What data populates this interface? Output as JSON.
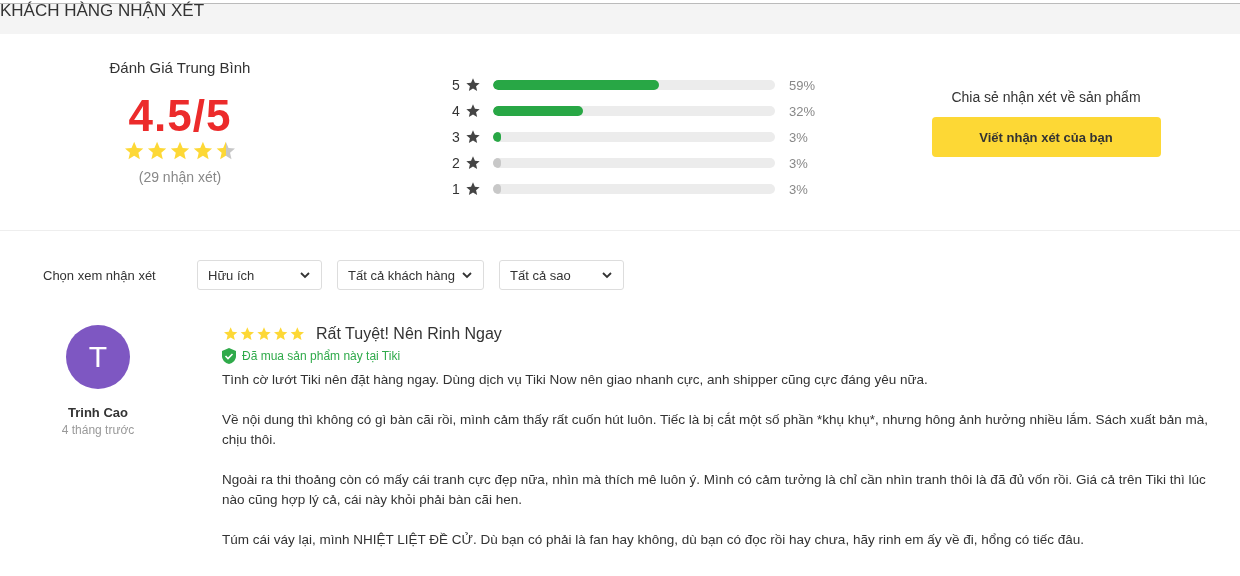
{
  "section_title": "KHÁCH HÀNG NHẬN XÉT",
  "summary": {
    "heading": "Đánh Giá Trung Bình",
    "score": "4.5/5",
    "stars": 4.5,
    "count": "(29 nhận xét)"
  },
  "distribution": [
    {
      "label": "5",
      "level": 0.59,
      "reading": "59%",
      "color": "#28a745"
    },
    {
      "label": "4",
      "level": 0.32,
      "reading": "32%",
      "color": "#28a745"
    },
    {
      "label": "3",
      "level": 0.03,
      "reading": "3%",
      "color": "#28a745"
    },
    {
      "label": "2",
      "level": 0.03,
      "reading": "3%",
      "color": "#c8c8c8"
    },
    {
      "label": "1",
      "level": 0.03,
      "reading": "3%",
      "color": "#c8c8c8"
    }
  ],
  "share": {
    "prompt": "Chia sẻ nhận xét về sản phẩm",
    "button": "Viết nhận xét của bạn"
  },
  "filter": {
    "label": "Chọn xem nhận xét",
    "dropdowns": [
      "Hữu ích",
      "Tất cả khách hàng",
      "Tất cả sao"
    ]
  },
  "reviews": [
    {
      "avatar_letter": "T",
      "author": "Trinh Cao",
      "time": "4 tháng trước",
      "stars": 5,
      "title": "Rất Tuyệt! Nên Rinh Ngay",
      "verified": true,
      "verified_text": "Đã mua sản phẩm này tại Tiki",
      "paragraphs": [
        "Tình cờ lướt Tiki nên đặt hàng ngay. Dùng dịch vụ Tiki Now nên giao nhanh cực, anh shipper cũng cực đáng yêu nữa.",
        "Về nội dung thì không có gì bàn cãi rồi, mình cảm thấy rất cuốn hút luôn. Tiếc là bị cắt một số phần *khụ khụ*, nhưng hông ảnh hưởng nhiều lắm. Sách xuất bản mà, chịu thôi.",
        "Ngoài ra thi thoảng còn có mấy cái tranh cực đẹp nữa, nhìn mà thích mê luôn ý. Mình có cảm tưởng là chỉ cần nhìn tranh thôi là đã đủ vốn rồi. Giá cả trên Tiki thì lúc nào cũng hợp lý cả, cái này khỏi phải bàn cãi hen.",
        "Túm cái váy lại, mình NHIỆT LIỆT ĐỀ CỬ. Dù bạn có phải là fan hay không, dù bạn có đọc rồi hay chưa, hãy rinh em ấy về đi, hổng có tiếc đâu."
      ]
    }
  ]
}
